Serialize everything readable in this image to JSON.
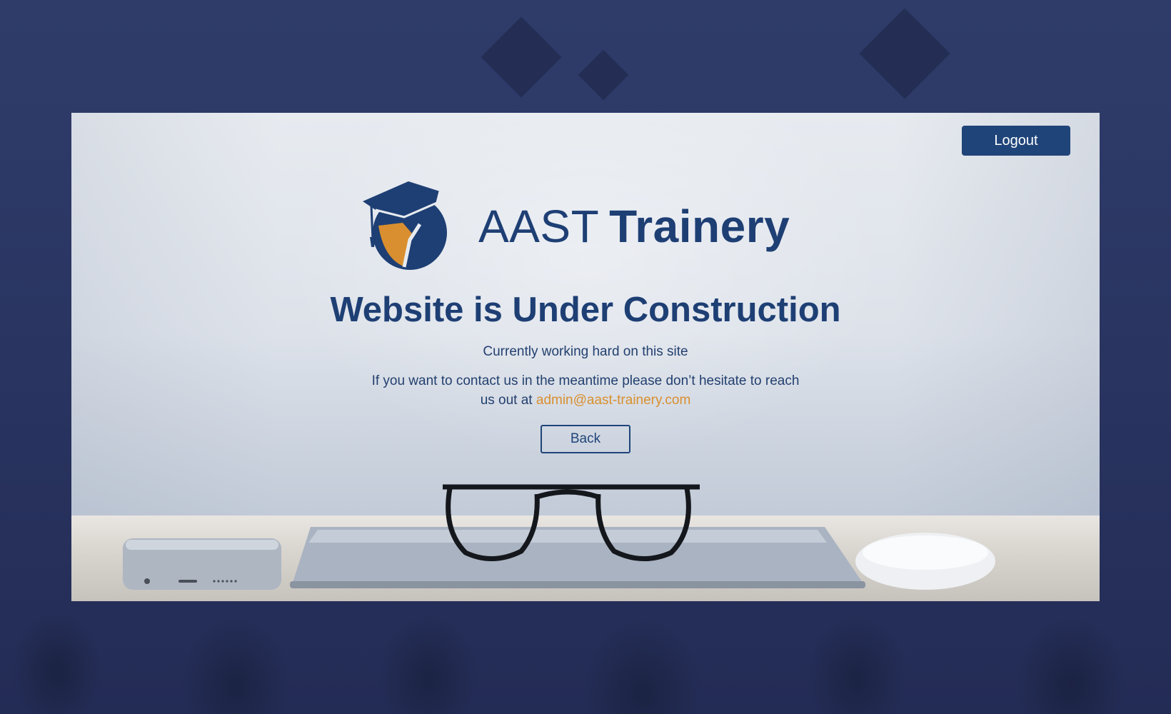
{
  "header": {
    "logout_label": "Logout"
  },
  "brand": {
    "name_thin": "AAST",
    "name_bold": "Trainery",
    "primary_color": "#1e3f74",
    "accent_color": "#d98f2f"
  },
  "main": {
    "headline": "Website is Under Construction",
    "subline": "Currently working hard on this site",
    "contact_text": "If you want to contact us in the meantime please don’t hesitate to reach us out at",
    "contact_email": "admin@aast-trainery.com",
    "back_label": "Back"
  }
}
